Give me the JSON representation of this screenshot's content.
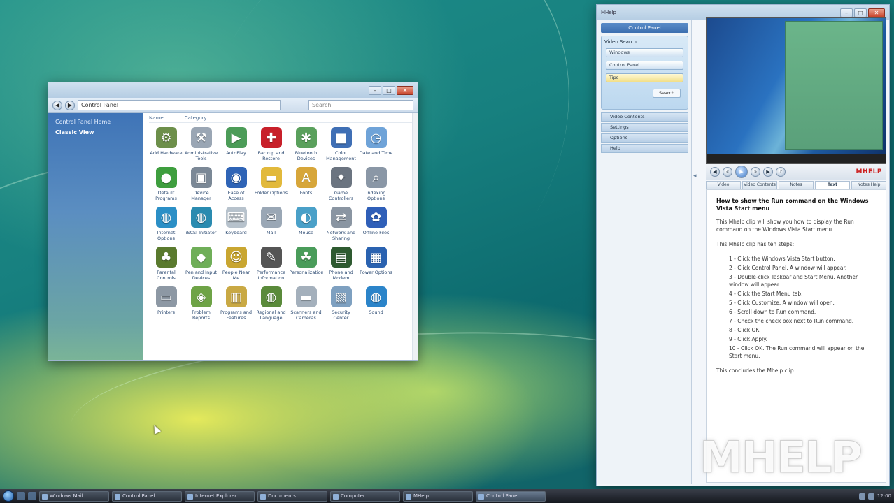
{
  "control_panel": {
    "address": "Control Panel",
    "search_placeholder": "Search",
    "sidebar": [
      {
        "label": "Control Panel Home",
        "selected": false
      },
      {
        "label": "Classic View",
        "selected": true
      }
    ],
    "column_headers": [
      "Name",
      "Category"
    ],
    "items": [
      {
        "label": "Add Hardware",
        "icon": "hardware-icon",
        "color": "#6d8f4a",
        "glyph": "⚙"
      },
      {
        "label": "Administrative Tools",
        "icon": "admin-tools-icon",
        "color": "#9aa6b4",
        "glyph": "⚒"
      },
      {
        "label": "AutoPlay",
        "icon": "autoplay-icon",
        "color": "#4c9c58",
        "glyph": "▶"
      },
      {
        "label": "Backup and Restore Center",
        "icon": "backup-icon",
        "color": "#c8202a",
        "glyph": "✚"
      },
      {
        "label": "Bluetooth Devices",
        "icon": "bluetooth-icon",
        "color": "#5aa05c",
        "glyph": "✱"
      },
      {
        "label": "Color Management",
        "icon": "color-mgmt-icon",
        "color": "#3f6fb5",
        "glyph": "■"
      },
      {
        "label": "Date and Time",
        "icon": "clock-icon",
        "color": "#6fa3d8",
        "glyph": "◷"
      },
      {
        "label": "Default Programs",
        "icon": "default-programs-icon",
        "color": "#3e9e3e",
        "glyph": "●"
      },
      {
        "label": "Device Manager",
        "icon": "device-manager-icon",
        "color": "#7b8896",
        "glyph": "▣"
      },
      {
        "label": "Ease of Access",
        "icon": "ease-access-icon",
        "color": "#2f64b6",
        "glyph": "◉"
      },
      {
        "label": "Folder Options",
        "icon": "folder-icon",
        "color": "#e2b93b",
        "glyph": "▬"
      },
      {
        "label": "Fonts",
        "icon": "fonts-icon",
        "color": "#d7a63a",
        "glyph": "A"
      },
      {
        "label": "Game Controllers",
        "icon": "game-controller-icon",
        "color": "#6b7480",
        "glyph": "✦"
      },
      {
        "label": "Indexing Options",
        "icon": "indexing-icon",
        "color": "#8a97a6",
        "glyph": "⌕"
      },
      {
        "label": "Internet Options",
        "icon": "internet-icon",
        "color": "#2b8fc6",
        "glyph": "◍"
      },
      {
        "label": "iSCSI Initiator",
        "icon": "iscsi-icon",
        "color": "#2a8bb0",
        "glyph": "◍"
      },
      {
        "label": "Keyboard",
        "icon": "keyboard-icon",
        "color": "#b7c2cc",
        "glyph": "⌨"
      },
      {
        "label": "Mail",
        "icon": "mail-icon",
        "color": "#9aa7b5",
        "glyph": "✉"
      },
      {
        "label": "Mouse",
        "icon": "mouse-icon",
        "color": "#4aa0c8",
        "glyph": "◐"
      },
      {
        "label": "Network and Sharing Center",
        "icon": "network-icon",
        "color": "#8a95a2",
        "glyph": "⇄"
      },
      {
        "label": "Offline Files",
        "icon": "offline-files-icon",
        "color": "#2f5fb8",
        "glyph": "✿"
      },
      {
        "label": "Parental Controls",
        "icon": "parental-controls-icon",
        "color": "#5a7a2e",
        "glyph": "♣"
      },
      {
        "label": "Pen and Input Devices",
        "icon": "pen-input-icon",
        "color": "#6fae58",
        "glyph": "◆"
      },
      {
        "label": "People Near Me",
        "icon": "people-near-me-icon",
        "color": "#c9a631",
        "glyph": "☺"
      },
      {
        "label": "Performance Information",
        "icon": "performance-icon",
        "color": "#555",
        "glyph": "✎"
      },
      {
        "label": "Personalization",
        "icon": "personalization-icon",
        "color": "#4a9c5a",
        "glyph": "☘"
      },
      {
        "label": "Phone and Modem",
        "icon": "phone-modem-icon",
        "color": "#2e5a30",
        "glyph": "▤"
      },
      {
        "label": "Power Options",
        "icon": "power-icon",
        "color": "#2a62b0",
        "glyph": "▦"
      },
      {
        "label": "Printers",
        "icon": "printer-icon",
        "color": "#8d98a4",
        "glyph": "▭"
      },
      {
        "label": "Problem Reports",
        "icon": "problem-reports-icon",
        "color": "#6ea346",
        "glyph": "◈"
      },
      {
        "label": "Programs and Features",
        "icon": "programs-icon",
        "color": "#c9a944",
        "glyph": "▥"
      },
      {
        "label": "Regional and Language",
        "icon": "regional-icon",
        "color": "#5a8a3a",
        "glyph": "◍"
      },
      {
        "label": "Scanners and Cameras",
        "icon": "scanner-icon",
        "color": "#a4b0bc",
        "glyph": "▬"
      },
      {
        "label": "Security Center",
        "icon": "security-icon",
        "color": "#7ea0c0",
        "glyph": "▧"
      },
      {
        "label": "Sound",
        "icon": "sound-icon",
        "color": "#2b84c9",
        "glyph": "◍"
      }
    ]
  },
  "help_window": {
    "title": "MHelp",
    "panel_header": "Control Panel",
    "search": {
      "title": "Video Search",
      "field1": "Windows",
      "field2": "Control Panel",
      "field3": "Tips",
      "button": "Search"
    },
    "nav_rows": [
      "Video Contents",
      "Settings",
      "Options",
      "Help"
    ],
    "tabs": [
      "Video",
      "Video Contents",
      "Notes",
      "Text",
      "Notes Help"
    ],
    "active_tab_index": 3,
    "brand": "MHELP",
    "article": {
      "heading": "How to show the Run command on the Windows Vista Start menu",
      "intro": "This Mhelp clip will show you how to display the Run command on the Windows Vista Start menu.",
      "steps_intro": "This Mhelp clip has ten steps:",
      "steps": [
        "1 - Click the Windows Vista Start button.",
        "2 - Click Control Panel. A window will appear.",
        "3 - Double-click Taskbar and Start Menu. Another window will appear.",
        "4 - Click the Start Menu tab.",
        "5 - Click Customize. A window will open.",
        "6 - Scroll down to Run command.",
        "7 - Check the check box next to Run command.",
        "8 - Click OK.",
        "9 - Click Apply.",
        "10 - Click OK. The Run command will appear on the Start menu."
      ],
      "outro": "This concludes the Mhelp clip."
    },
    "watermark": "MHELP"
  },
  "taskbar": {
    "buttons": [
      "Windows Mail",
      "Control Panel",
      "Internet Explorer",
      "Documents",
      "Computer",
      "MHelp",
      "Control Panel"
    ],
    "active_index": 6,
    "clock": "12:00"
  }
}
